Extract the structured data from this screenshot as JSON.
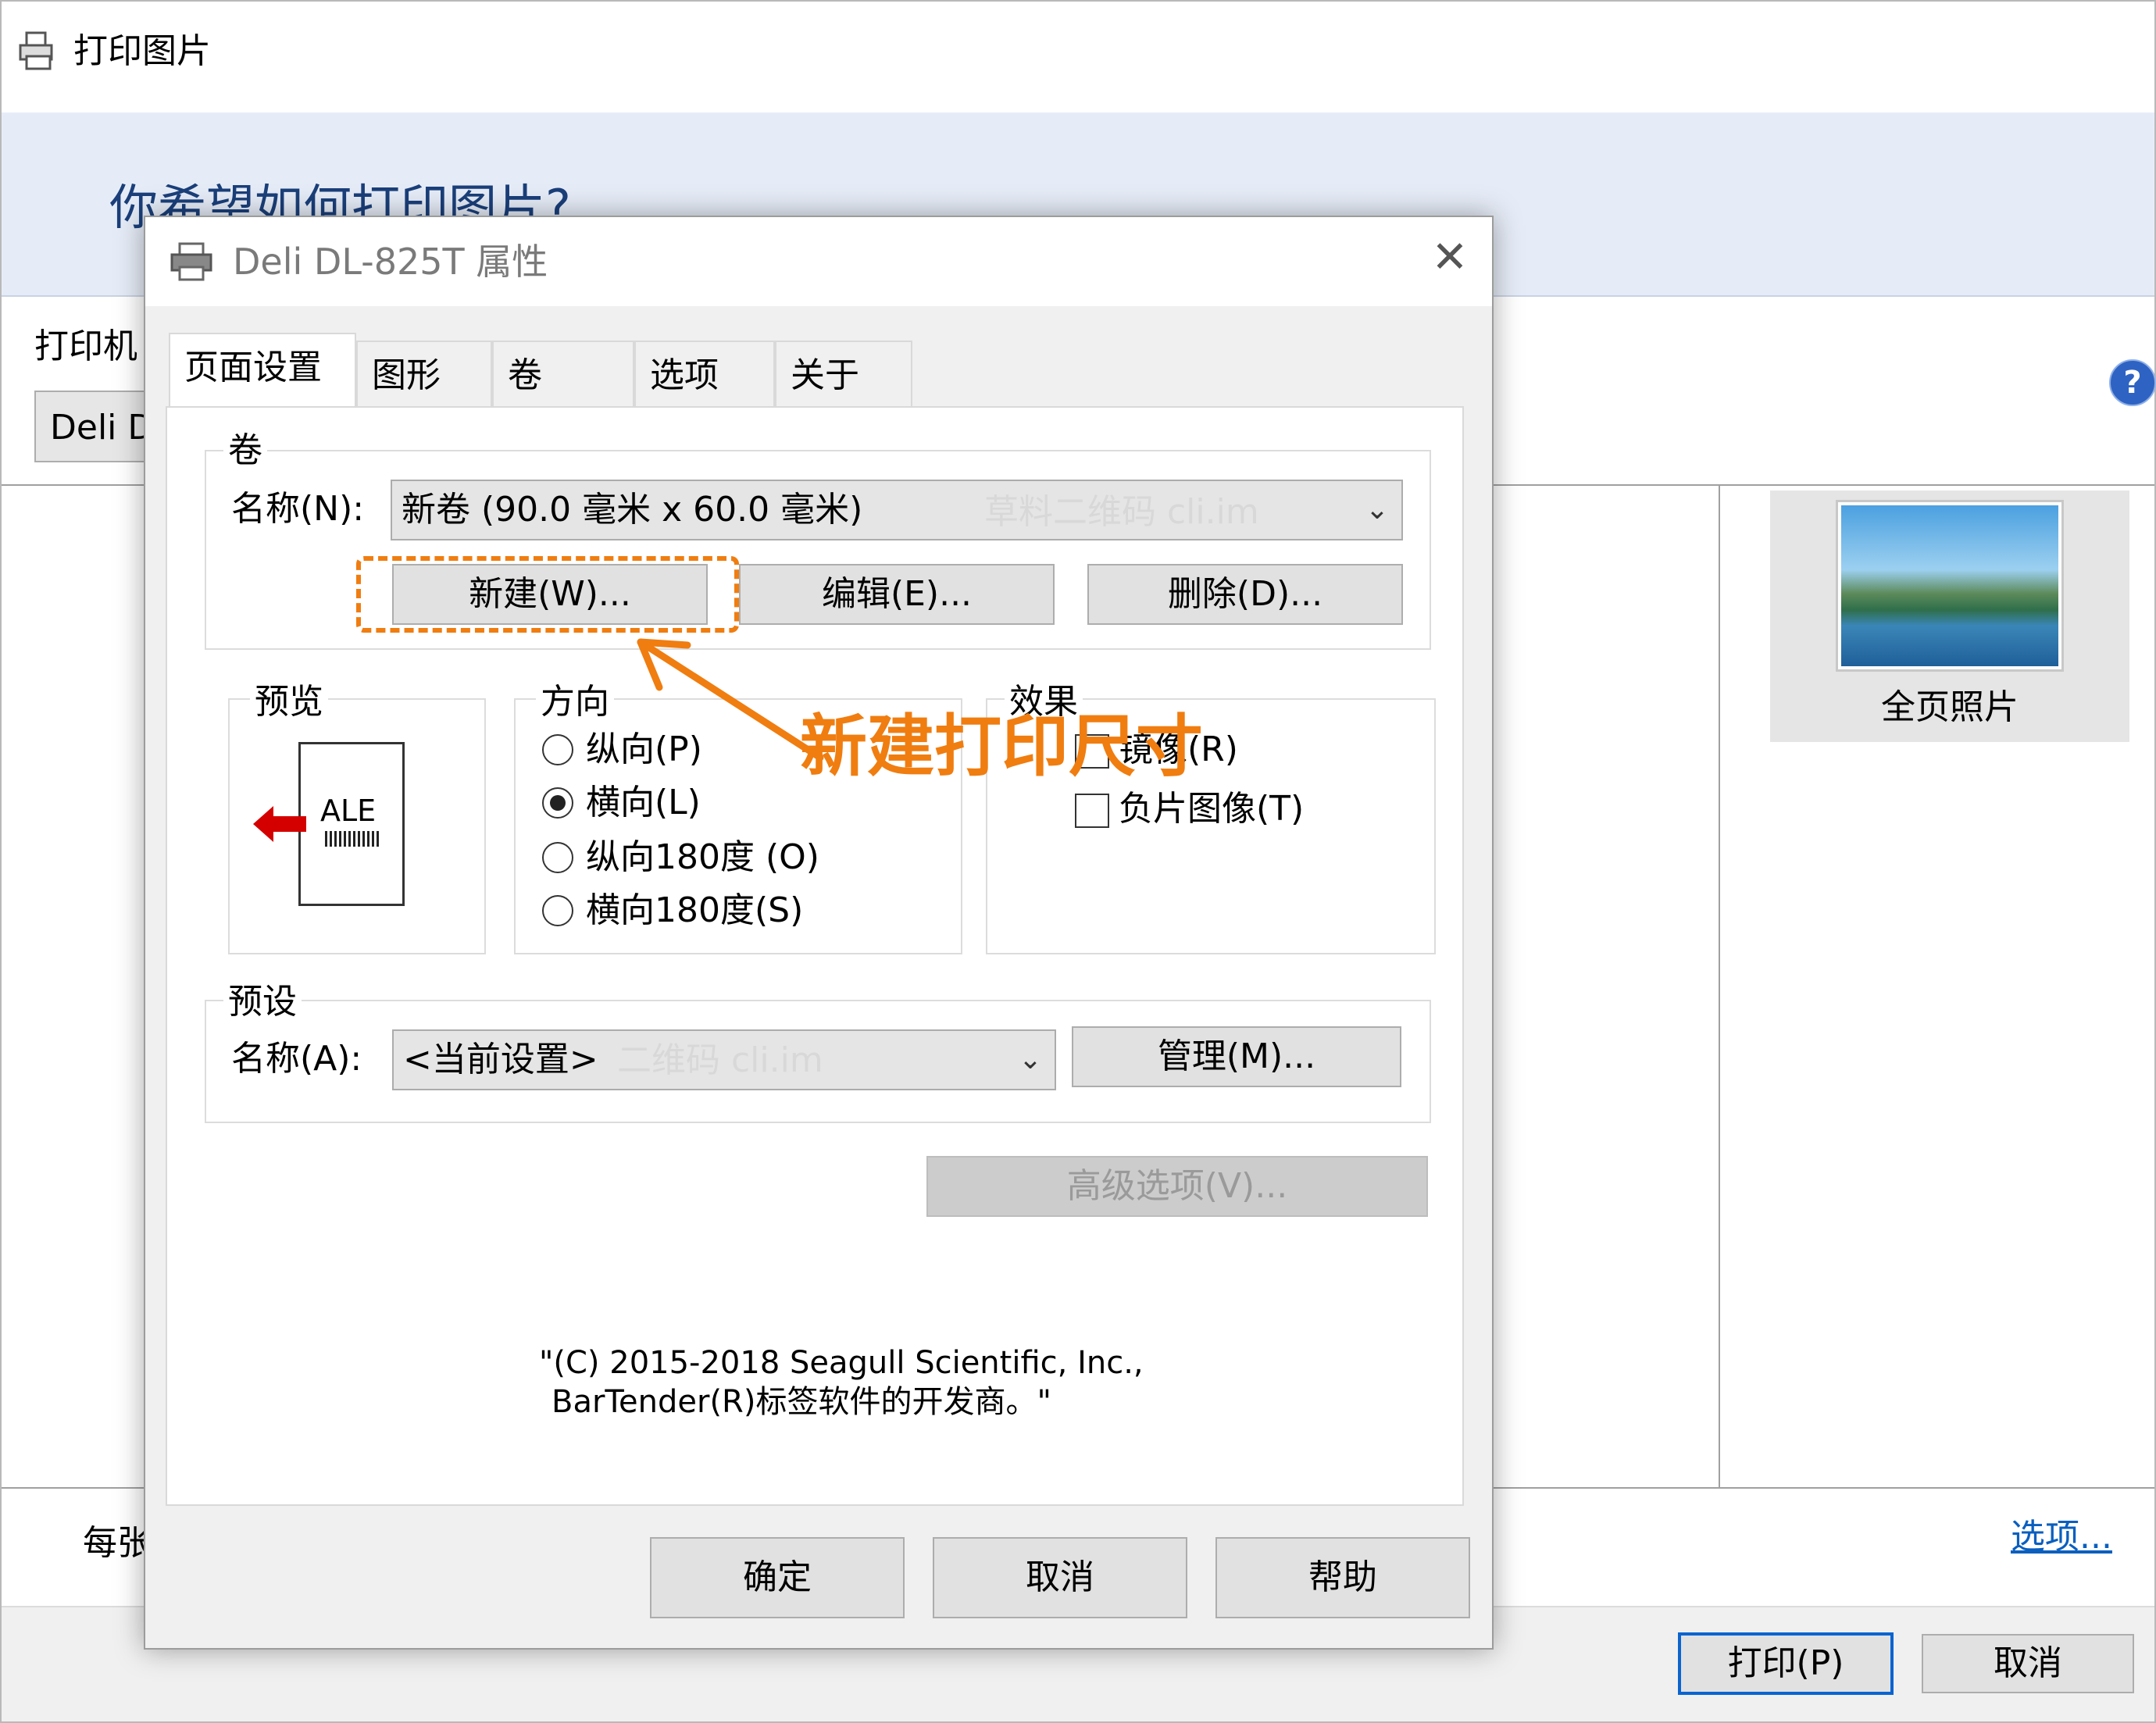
{
  "background_window": {
    "title": "打印图片",
    "banner_text": "你希望如何打印图片?",
    "printer_label": "打印机",
    "printer_value": "Deli D",
    "layout_option_label": "全页照片",
    "per_page_label": "每张",
    "options_link": "选项...",
    "print_button": "打印(P)",
    "cancel_button": "取消",
    "help_icon": "?"
  },
  "dialog": {
    "title": "Deli DL-825T 属性",
    "close_glyph": "✕",
    "tabs": [
      {
        "label": "页面设置",
        "active": true
      },
      {
        "label": "图形"
      },
      {
        "label": "卷"
      },
      {
        "label": "选项"
      },
      {
        "label": "关于"
      }
    ],
    "roll_group": {
      "title": "卷",
      "name_label": "名称(N):",
      "name_value": "新卷 (90.0 毫米 x 60.0 毫米)",
      "watermark": "草料二维码 cli.im",
      "new_button": "新建(W)...",
      "edit_button": "编辑(E)...",
      "delete_button": "删除(D)..."
    },
    "preview_group": {
      "title": "预览",
      "card_text": "ALE"
    },
    "orientation_group": {
      "title": "方向",
      "options": [
        {
          "label": "纵向(P)",
          "selected": false
        },
        {
          "label": "横向(L)",
          "selected": true
        },
        {
          "label": "纵向180度 (O)",
          "selected": false
        },
        {
          "label": "横向180度(S)",
          "selected": false
        }
      ]
    },
    "effects_group": {
      "title": "效果",
      "options": [
        {
          "label": "镜像(R)",
          "checked": false
        },
        {
          "label": "负片图像(T)",
          "checked": false
        }
      ]
    },
    "preset_group": {
      "title": "预设",
      "name_label": "名称(A):",
      "name_value": "<当前设置>",
      "watermark": "二维码 cli.im",
      "manage_button": "管理(M)..."
    },
    "advanced_button": "高级选项(V)...",
    "copyright_line1": "\"(C) 2015-2018 Seagull Scientific, Inc.,",
    "copyright_line2": "BarTender(R)标签软件的开发商。\"",
    "ok_button": "确定",
    "cancel_button": "取消",
    "help_button": "帮助"
  },
  "annotation": {
    "text": "新建打印尺寸",
    "color": "#f07d10"
  },
  "colors": {
    "banner_bg": "#e6ecf7",
    "accent_blue": "#0a64d0",
    "annotation_orange": "#f07d10"
  }
}
